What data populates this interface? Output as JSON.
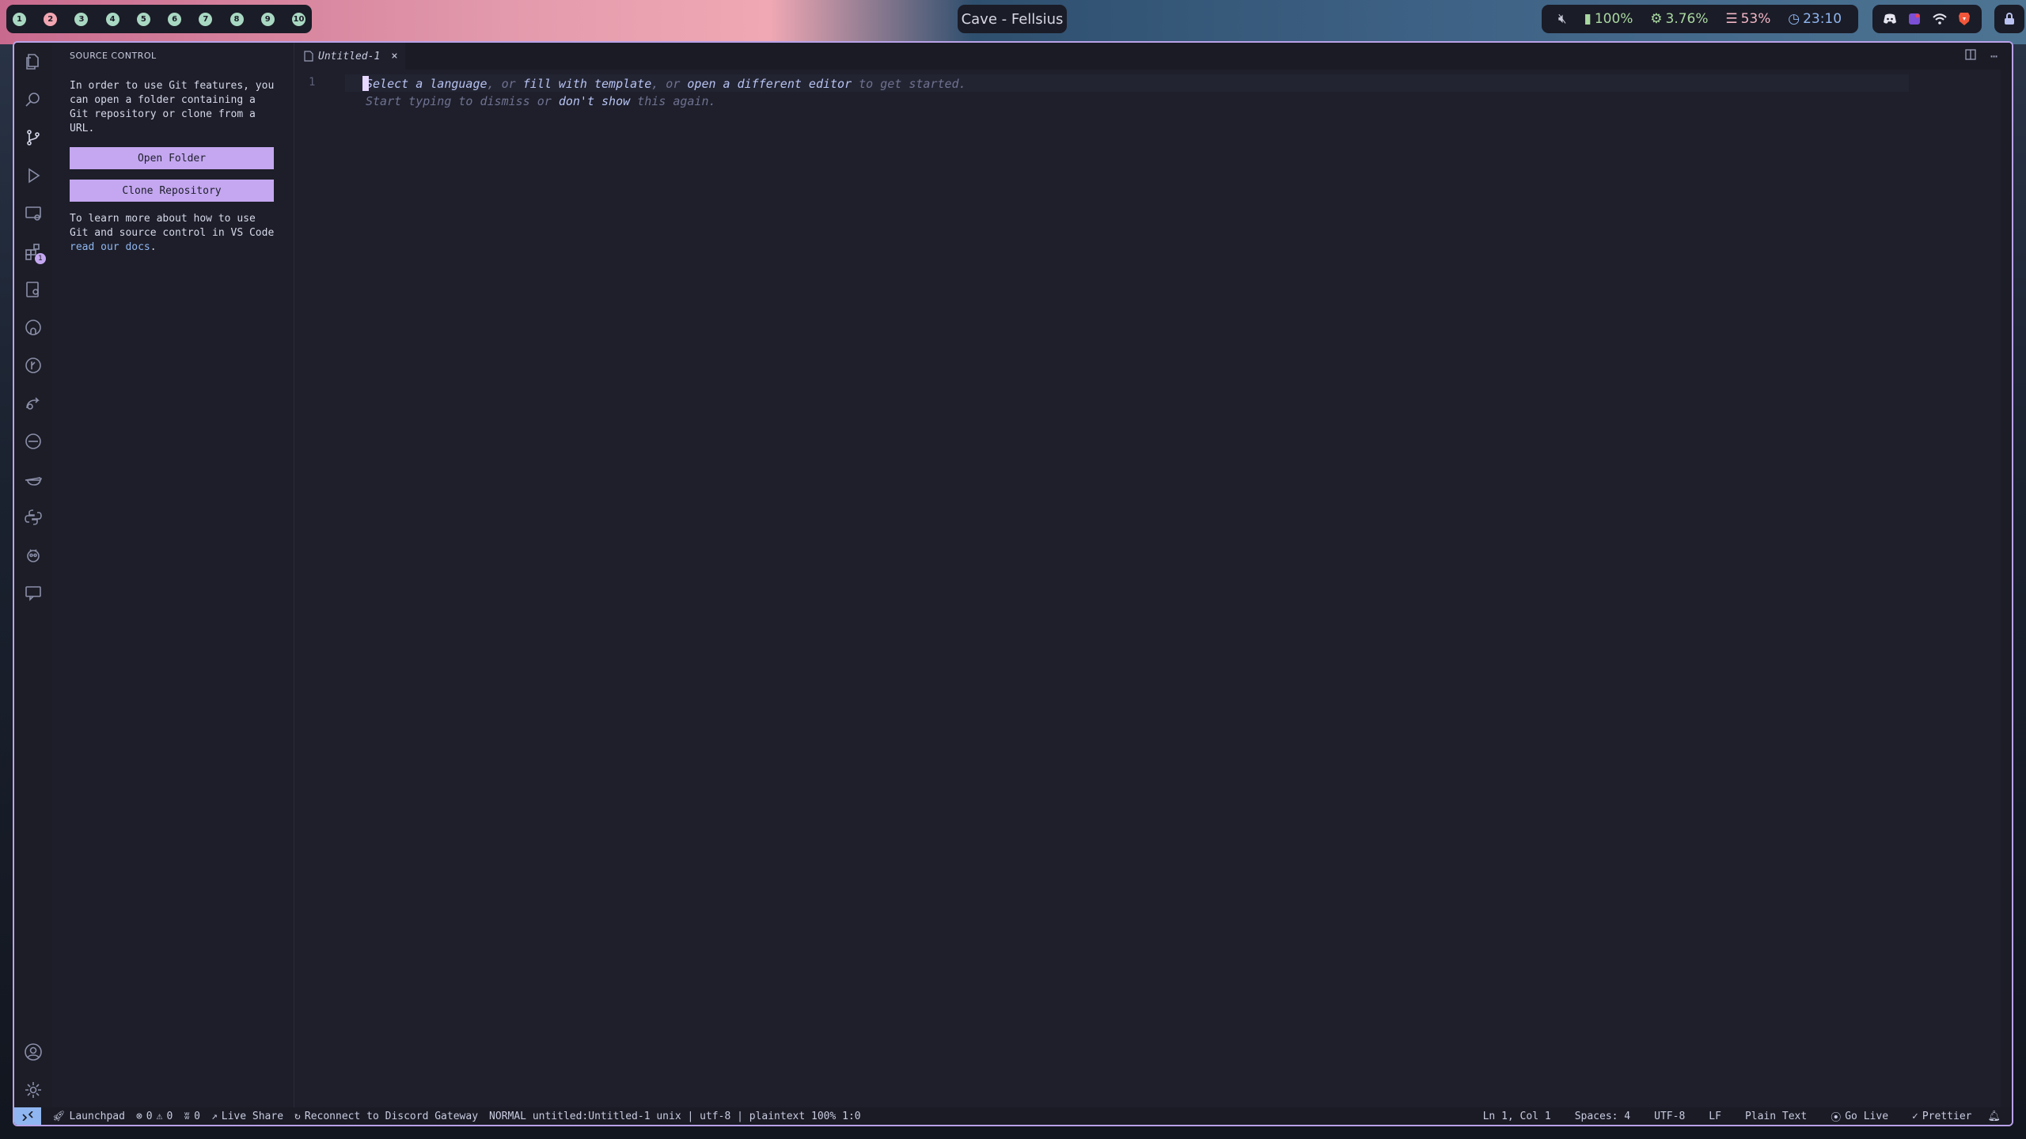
{
  "desktop": {
    "workspaces": [
      "1",
      "2",
      "3",
      "4",
      "5",
      "6",
      "7",
      "8",
      "9",
      "10"
    ],
    "active_workspace_index": 1,
    "window_title": "Cave - Fellsius",
    "tray": {
      "volume_icon": "muted-speaker-icon",
      "battery": "100%",
      "cpu": "3.76%",
      "memory": "53%",
      "clock": "23:10"
    },
    "apps": [
      "discord-icon",
      "app-icon",
      "wifi-icon",
      "brave-icon"
    ]
  },
  "vscode": {
    "sidebar": {
      "title": "SOURCE CONTROL",
      "intro": "In order to use Git features, you can open a folder containing a Git repository or clone from a URL.",
      "open_folder": "Open Folder",
      "clone_repo": "Clone Repository",
      "learn_prefix": "To learn more about how to use Git and source control in VS Code ",
      "learn_link": "read our docs",
      "learn_suffix": "."
    },
    "activity_badge": "1",
    "tab": {
      "label": "Untitled-1",
      "close": "×"
    },
    "editor": {
      "line_number": "1",
      "hint_line1": {
        "p0": "Select a language",
        "p1": ", or ",
        "p2": "fill with template",
        "p3": ", or ",
        "p4": "open a different editor",
        "p5": " to get started."
      },
      "hint_line2": {
        "p0": "Start typing to dismiss or ",
        "p1": "don't show",
        "p2": " this again."
      }
    },
    "statusbar": {
      "launchpad": "Launchpad",
      "errors": "0",
      "warnings": "0",
      "ports": "0",
      "live_share": "Live Share",
      "discord": "Reconnect to Discord Gateway",
      "vim_mode": "NORMAL untitled:Untitled-1 unix | utf-8 | plaintext 100% 1:0",
      "position": "Ln 1, Col 1",
      "spaces": "Spaces: 4",
      "encoding": "UTF-8",
      "eol": "LF",
      "language": "Plain Text",
      "go_live": "Go Live",
      "prettier": "Prettier"
    }
  }
}
